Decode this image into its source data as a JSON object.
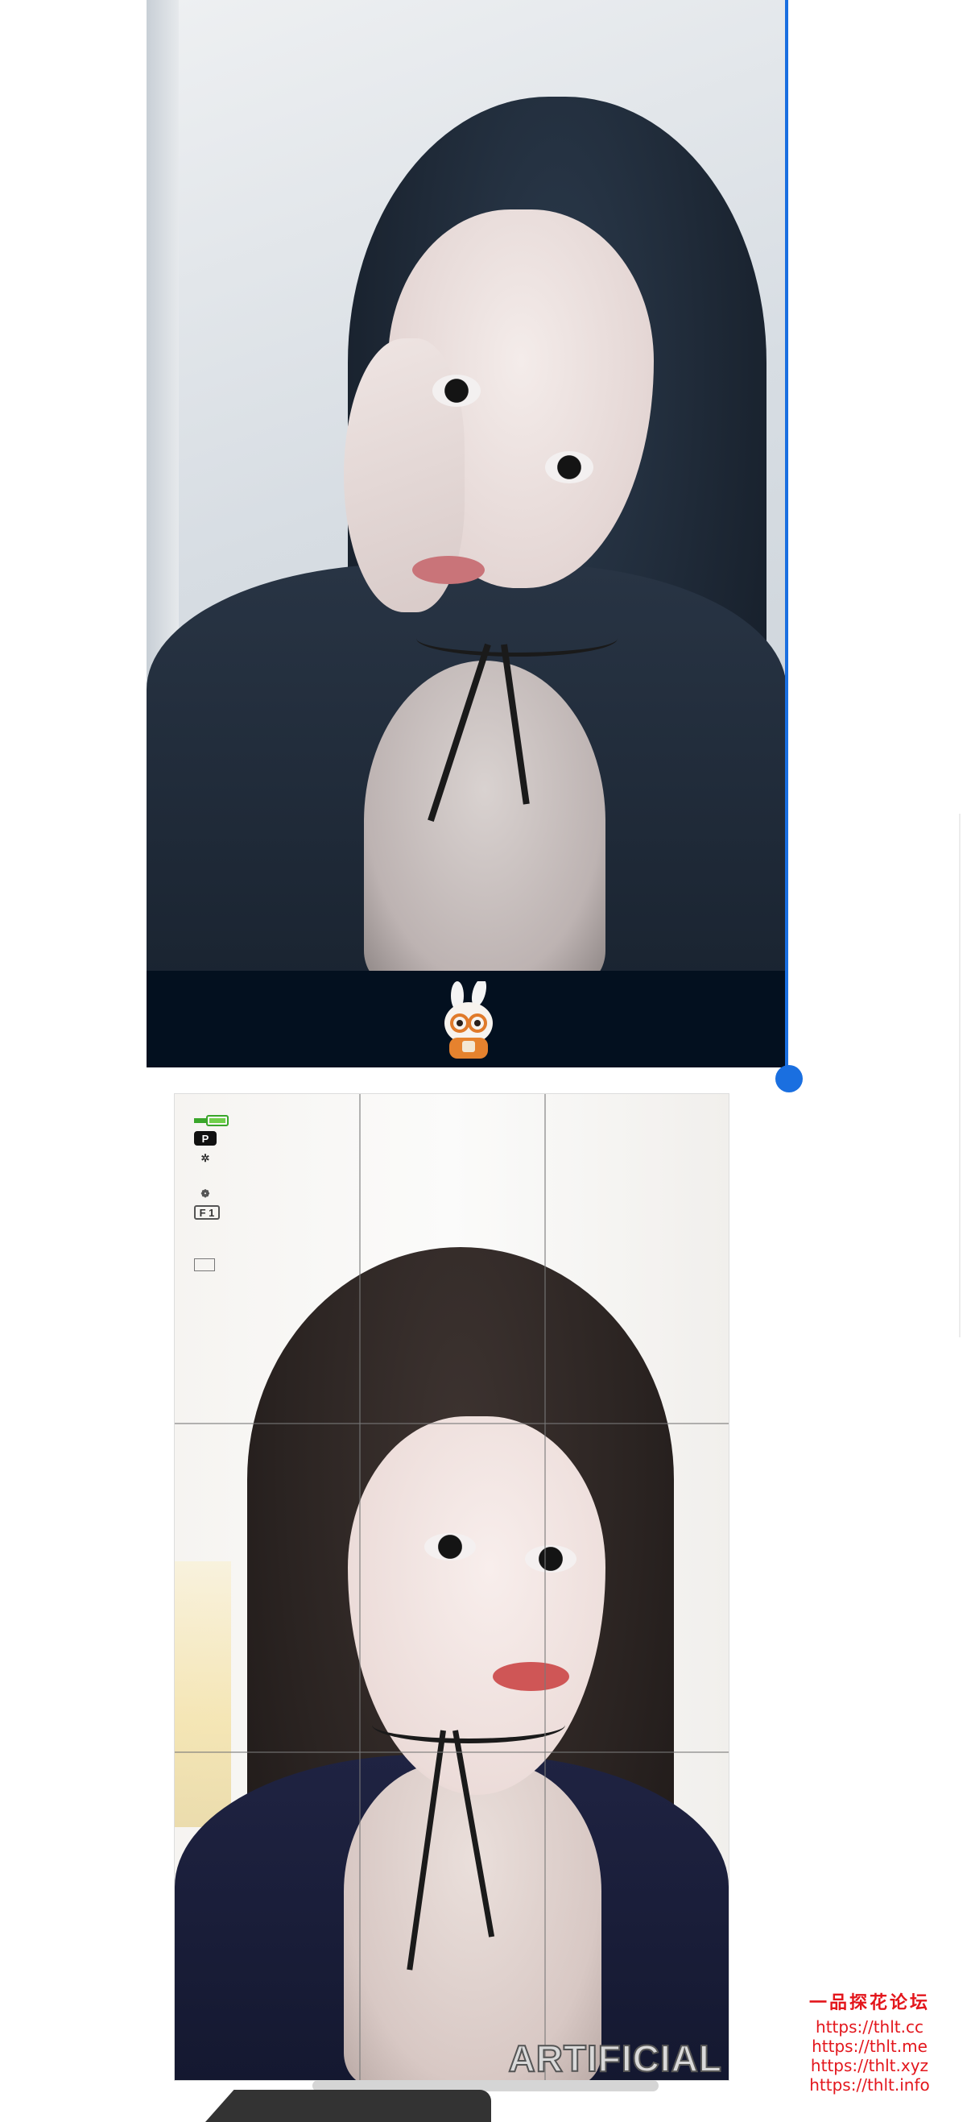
{
  "top_image": {
    "mascot_icon": "bunny-mascot-with-glasses",
    "bottom_bar_color": "#03101f"
  },
  "selection": {
    "accent_color": "#1a6fe0"
  },
  "bottom_image": {
    "camera_overlay": {
      "mode": "P",
      "aperture_label": "F 1",
      "icons": [
        "battery-icon",
        "flash-off-icon",
        "white-balance-icon",
        "card-icon"
      ]
    },
    "watermark": "ARTIFICIAL"
  },
  "site_watermark": {
    "title": "一品探花论坛",
    "urls": [
      "https://thlt.cc",
      "https://thlt.me",
      "https://thlt.xyz",
      "https://thlt.info"
    ],
    "color": "#e3161c"
  }
}
